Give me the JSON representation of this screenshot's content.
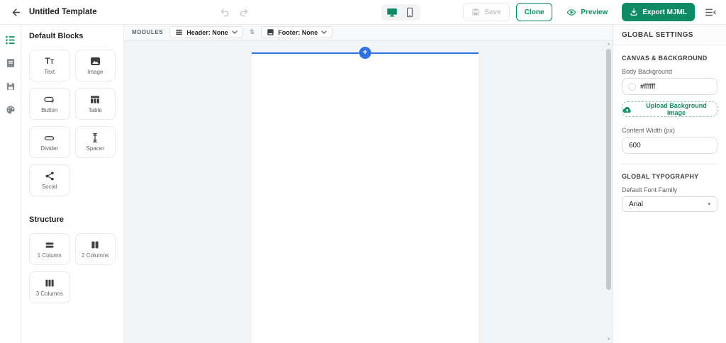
{
  "topbar": {
    "title": "Untitled Template",
    "save": "Save",
    "clone": "Clone",
    "preview": "Preview",
    "export": "Export MJML"
  },
  "blocks_panel": {
    "default_heading": "Default Blocks",
    "blocks": [
      {
        "label": "Text"
      },
      {
        "label": "Image"
      },
      {
        "label": "Button"
      },
      {
        "label": "Table"
      },
      {
        "label": "Divider"
      },
      {
        "label": "Spacer"
      },
      {
        "label": "Social"
      }
    ],
    "structure_heading": "Structure",
    "structures": [
      {
        "label": "1 Column"
      },
      {
        "label": "2 Columns"
      },
      {
        "label": "3 Columns"
      }
    ]
  },
  "modules_bar": {
    "label": "MODULES",
    "header_value": "Header: None",
    "footer_value": "Footer: None"
  },
  "canvas": {
    "add_label": "+"
  },
  "global_settings": {
    "title": "GLOBAL SETTINGS",
    "canvas_background_heading": "CANVAS & BACKGROUND",
    "body_background_label": "Body Background",
    "body_background_value": "#ffffff",
    "upload_button": "Upload Background Image",
    "content_width_label": "Content Width (px)",
    "content_width_value": "600",
    "typography_heading": "GLOBAL TYPOGRAPHY",
    "font_family_label": "Default Font Family",
    "font_family_value": "Arial"
  },
  "icons": {
    "swap_vertical": "⇅",
    "chevron_down": "▾",
    "scroll_up": "▲",
    "scroll_down": "▼",
    "text_block_large": "T",
    "text_block_small": "T"
  },
  "colors": {
    "accent_green": "#0e8a65",
    "accent_blue": "#3171e2",
    "canvas_background": "#f1f3f4"
  }
}
